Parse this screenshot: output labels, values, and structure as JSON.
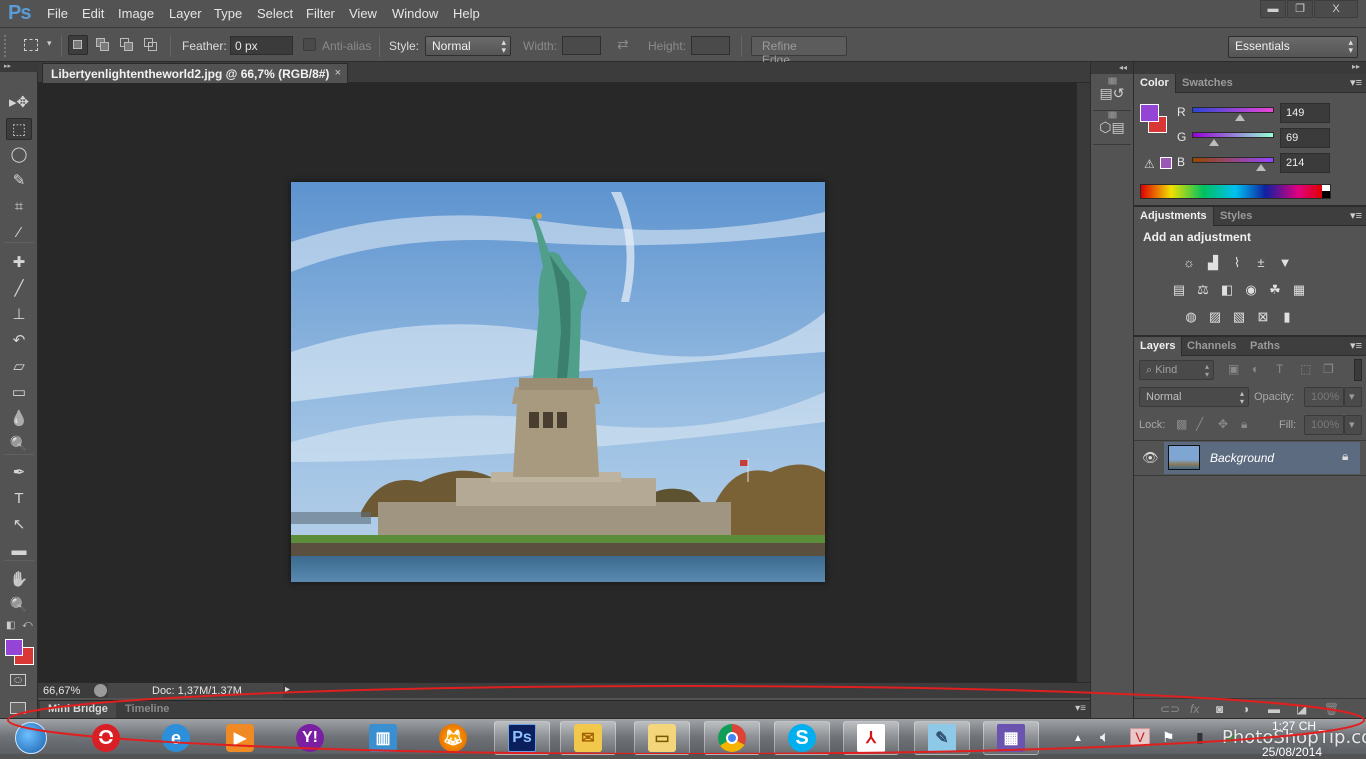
{
  "app": {
    "logo": "Ps",
    "menus": [
      "File",
      "Edit",
      "Image",
      "Layer",
      "Type",
      "Select",
      "Filter",
      "View",
      "Window",
      "Help"
    ],
    "window_controls": {
      "minimize": "▬",
      "restore": "❐",
      "close": "X"
    }
  },
  "options_bar": {
    "tool_icon": "rect-marquee-icon",
    "feather_label": "Feather:",
    "feather_value": "0 px",
    "antialias_label": "Anti-alias",
    "antialias_checked": false,
    "style_label": "Style:",
    "style_value": "Normal",
    "width_label": "Width:",
    "width_value": "",
    "swap_icon": "⇄",
    "height_label": "Height:",
    "height_value": "",
    "refine_edge_label": "Refine Edge...",
    "workspace_value": "Essentials"
  },
  "document": {
    "tab_title": "Libertyenlightentheworld2.jpg @ 66,7% (RGB/8#)",
    "tab_close": "×",
    "zoom": "66,67%",
    "doc_info": "Doc: 1,37M/1.37M"
  },
  "tools": [
    {
      "name": "move-tool",
      "glyph": "▸✥"
    },
    {
      "name": "rect-marquee-tool",
      "glyph": "⬚",
      "active": true
    },
    {
      "name": "lasso-tool",
      "glyph": "◯"
    },
    {
      "name": "quick-selection-tool",
      "glyph": "✎"
    },
    {
      "name": "crop-tool",
      "glyph": "⌗"
    },
    {
      "name": "eyedropper-tool",
      "glyph": "⁄"
    },
    {
      "name": "healing-brush-tool",
      "glyph": "✚"
    },
    {
      "name": "brush-tool",
      "glyph": "╱"
    },
    {
      "name": "clone-stamp-tool",
      "glyph": "⊥"
    },
    {
      "name": "history-brush-tool",
      "glyph": "↶"
    },
    {
      "name": "eraser-tool",
      "glyph": "▱"
    },
    {
      "name": "gradient-tool",
      "glyph": "▭"
    },
    {
      "name": "blur-tool",
      "glyph": "💧"
    },
    {
      "name": "dodge-tool",
      "glyph": "🔍"
    },
    {
      "name": "pen-tool",
      "glyph": "✒"
    },
    {
      "name": "type-tool",
      "glyph": "T"
    },
    {
      "name": "path-selection-tool",
      "glyph": "↖"
    },
    {
      "name": "rectangle-tool",
      "glyph": "▬"
    },
    {
      "name": "hand-tool",
      "glyph": "✋"
    },
    {
      "name": "zoom-tool",
      "glyph": "🔍"
    }
  ],
  "colors": {
    "foreground": "#9545d6",
    "background": "#d93636"
  },
  "color_panel": {
    "tabs": [
      "Color",
      "Swatches"
    ],
    "channels": [
      {
        "label": "R",
        "value": "149",
        "fraction": 0.584
      },
      {
        "label": "G",
        "value": "69",
        "fraction": 0.27
      },
      {
        "label": "B",
        "value": "214",
        "fraction": 0.839
      }
    ]
  },
  "adjustments_panel": {
    "tabs": [
      "Adjustments",
      "Styles"
    ],
    "heading": "Add an adjustment",
    "rows": [
      [
        "brightness-contrast",
        "levels",
        "curves",
        "exposure",
        "vibrance"
      ],
      [
        "hue-saturation",
        "color-balance",
        "black-white",
        "photo-filter",
        "channel-mixer",
        "color-lookup"
      ],
      [
        "invert",
        "posterize",
        "threshold",
        "selective-color",
        "gradient-map"
      ]
    ]
  },
  "layers_panel": {
    "tabs": [
      "Layers",
      "Channels",
      "Paths"
    ],
    "filter_label": "Kind",
    "blend_mode": "Normal",
    "opacity_label": "Opacity:",
    "opacity_value": "100%",
    "lock_label": "Lock:",
    "fill_label": "Fill:",
    "fill_value": "100%",
    "layers": [
      {
        "name": "Background",
        "visible": true,
        "locked": true,
        "selected": true
      }
    ],
    "footer_icons": [
      "link-layers",
      "fx",
      "add-mask",
      "new-adjustment",
      "new-group",
      "new-layer",
      "delete-layer"
    ]
  },
  "bottom_panel": {
    "tabs": [
      "Mini Bridge",
      "Timeline"
    ]
  },
  "taskbar": {
    "apps": [
      "Start",
      "Opera",
      "Internet Explorer",
      "Windows Media Player",
      "Yahoo Messenger",
      "Windows Live Writer",
      "Firefox",
      "Photoshop",
      "Outlook",
      "Windows Explorer",
      "Chrome",
      "Skype",
      "Adobe Reader",
      "Notepad",
      "Unknown App"
    ],
    "clock_partial": "1:27 CH",
    "date_partial": "25/08/2014"
  },
  "watermark": "PhotoShopTip.com",
  "annotation": {
    "color": "#e01f1f"
  }
}
